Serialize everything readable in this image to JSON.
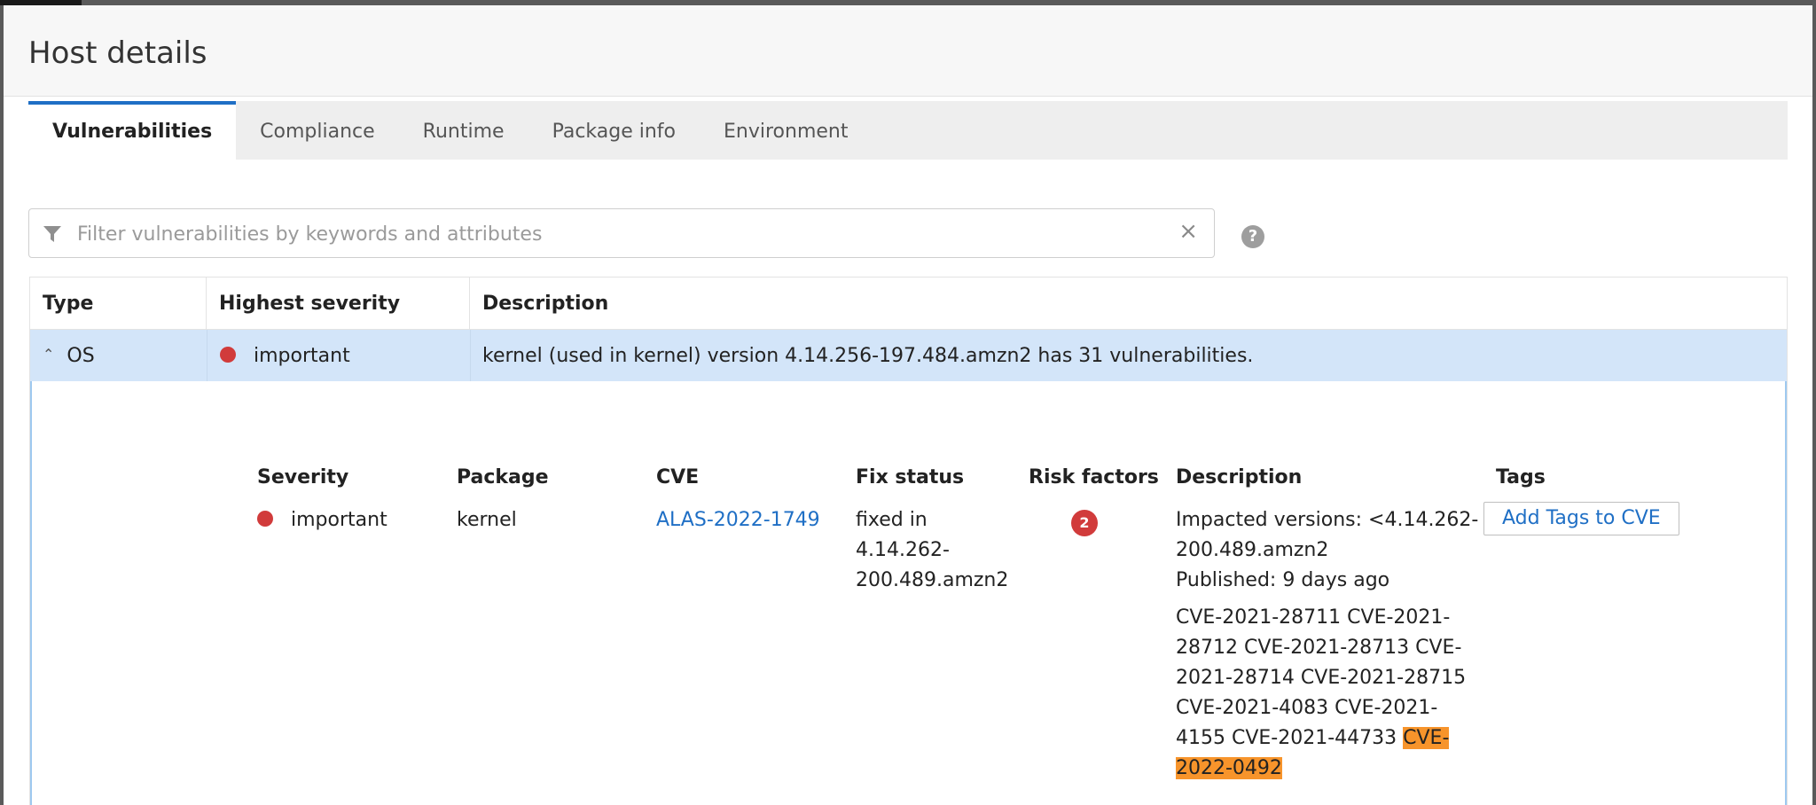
{
  "window": {
    "title": "Host details"
  },
  "tabs": [
    {
      "label": "Vulnerabilities",
      "active": true
    },
    {
      "label": "Compliance",
      "active": false
    },
    {
      "label": "Runtime",
      "active": false
    },
    {
      "label": "Package info",
      "active": false
    },
    {
      "label": "Environment",
      "active": false
    }
  ],
  "filter": {
    "placeholder": "Filter vulnerabilities by keywords and attributes",
    "value": "",
    "icon": "filter-icon",
    "clear_icon": "×",
    "help_icon": "?"
  },
  "table": {
    "headers": {
      "type": "Type",
      "severity": "Highest severity",
      "description": "Description"
    },
    "rows": [
      {
        "type": "OS",
        "severity": "important",
        "description": "kernel (used in kernel) version 4.14.256-197.484.amzn2 has 31 vulnerabilities.",
        "expanded": true
      }
    ]
  },
  "detail": {
    "headers": {
      "severity": "Severity",
      "package": "Package",
      "cve": "CVE",
      "fix_status": "Fix status",
      "risk_factors": "Risk factors",
      "description": "Description",
      "tags": "Tags"
    },
    "row": {
      "severity": "important",
      "package": "kernel",
      "cve": "ALAS-2022-1749",
      "fix_status_lines": [
        "fixed in",
        "4.14.262-",
        "200.489.amzn2"
      ],
      "risk_factors": "2",
      "impacted_lines": [
        "Impacted versions: <4.14.262-",
        "200.489.amzn2"
      ],
      "published": "Published: 9 days ago",
      "cve_list_lines": [
        "CVE-2021-28711 CVE-2021-",
        "28712 CVE-2021-28713 CVE-",
        "2021-28714 CVE-2021-28715",
        "CVE-2021-4083 CVE-2021-",
        "4155 CVE-2021-44733 "
      ],
      "cve_highlight_lines": [
        "CVE-",
        "2022-0492"
      ],
      "add_tags_label": "Add Tags to CVE"
    }
  },
  "colors": {
    "accent": "#1f6fc5",
    "severity_important": "#d13b3b",
    "row_selected": "#d3e5f9",
    "highlight": "#f7942b"
  }
}
